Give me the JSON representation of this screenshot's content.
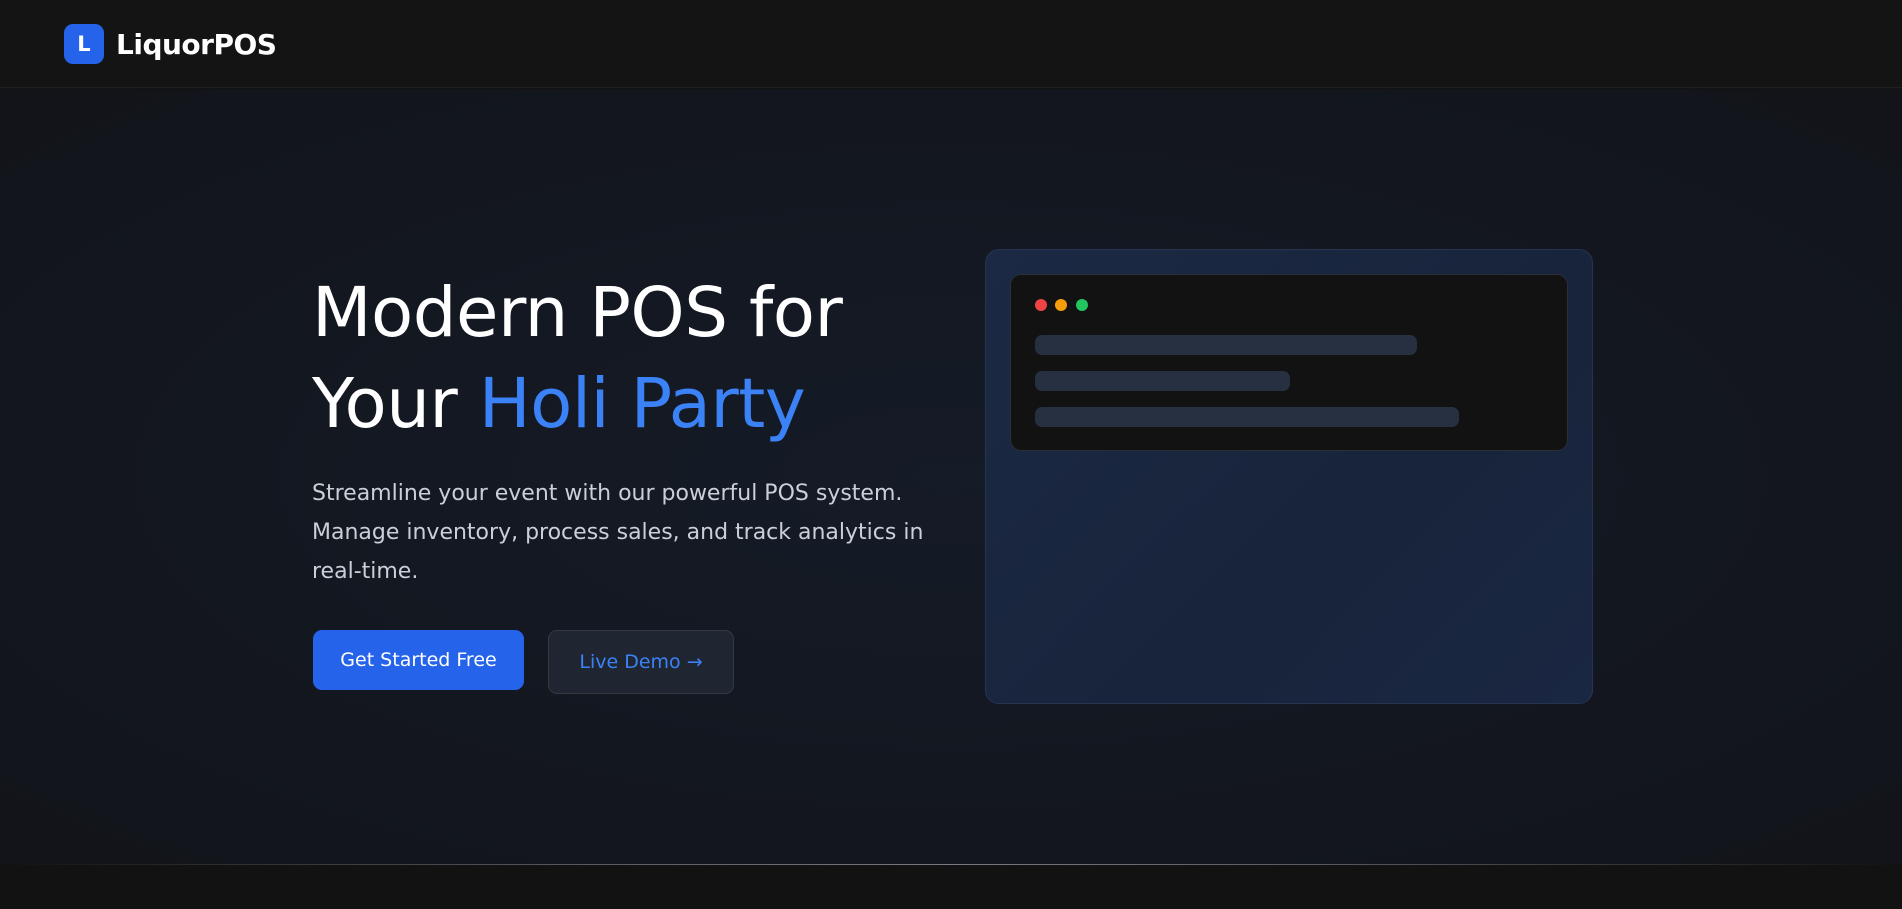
{
  "brand": {
    "mark": "L",
    "name": "LiquorPOS",
    "accent_color": "#2563eb"
  },
  "hero": {
    "headline_line1": "Modern POS for",
    "headline_line2_prefix": "Your",
    "headline_highlight": "Holi Party",
    "highlight_color": "#3b82f6",
    "subtext": "Streamline your event with our powerful POS system. Manage inventory, process sales, and track analytics in real-time.",
    "primary_button": "Get Started Free",
    "secondary_button": "Live Demo →"
  },
  "preview": {
    "window_controls": [
      "close-dot",
      "minimize-dot",
      "maximize-dot"
    ],
    "window_control_colors": [
      "#ef4444",
      "#f59e0b",
      "#22c55e"
    ]
  }
}
